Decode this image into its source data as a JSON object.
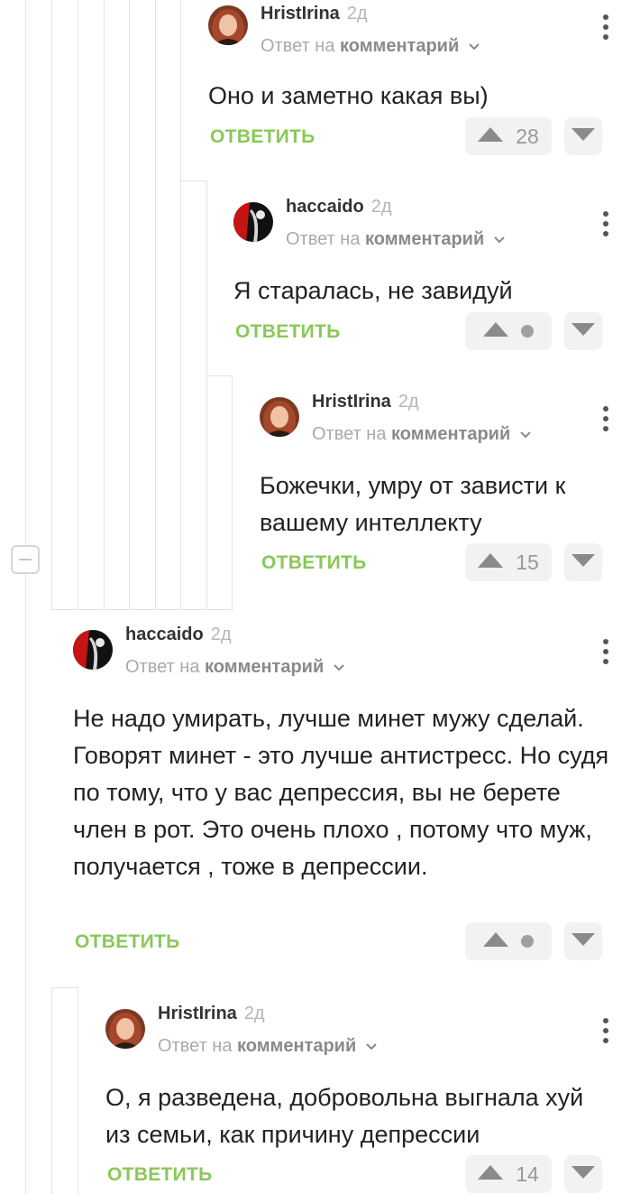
{
  "comments": [
    {
      "author": "HristIrina",
      "time": "2д",
      "reply_prefix": "Ответ на",
      "reply_target": "комментарий",
      "text": "Оно и заметно какая вы)",
      "reply_label": "ОТВЕТИТЬ",
      "rating": "28"
    },
    {
      "author": "haccaido",
      "time": "2д",
      "reply_prefix": "Ответ на",
      "reply_target": "комментарий",
      "text": "Я старалась, не завидуй",
      "reply_label": "ОТВЕТИТЬ",
      "rating": null
    },
    {
      "author": "HristIrina",
      "time": "2д",
      "reply_prefix": "Ответ на",
      "reply_target": "комментарий",
      "text": "Божечки, умру от зависти к вашему интеллекту",
      "reply_label": "ОТВЕТИТЬ",
      "rating": "15"
    },
    {
      "author": "haccaido",
      "time": "2д",
      "reply_prefix": "Ответ на",
      "reply_target": "комментарий",
      "text": "Не надо умирать, лучше минет мужу сделай. Говорят минет - это лучше антистресс. Но судя по тому, что у вас депрессия, вы не берете член в рот. Это очень плохо , потому что муж, получается , тоже в депрессии.",
      "reply_label": "ОТВЕТИТЬ",
      "rating": null
    },
    {
      "author": "HristIrina",
      "time": "2д",
      "reply_prefix": "Ответ на",
      "reply_target": "комментарий",
      "text": "О, я разведена, добровольна выгнала хуй из семьи, как причину депрессии",
      "reply_label": "ОТВЕТИТЬ",
      "rating": "14"
    }
  ],
  "icons": {
    "collapse": "minus-square-icon",
    "menu": "vertical-dots-icon",
    "upvote": "triangle-up-icon",
    "downvote": "triangle-down-icon",
    "chevron": "chevron-down-icon"
  },
  "colors": {
    "reply_link": "#8ac858",
    "thread_line": "#e3e3e3",
    "vote_bg": "#f2f2f2"
  }
}
